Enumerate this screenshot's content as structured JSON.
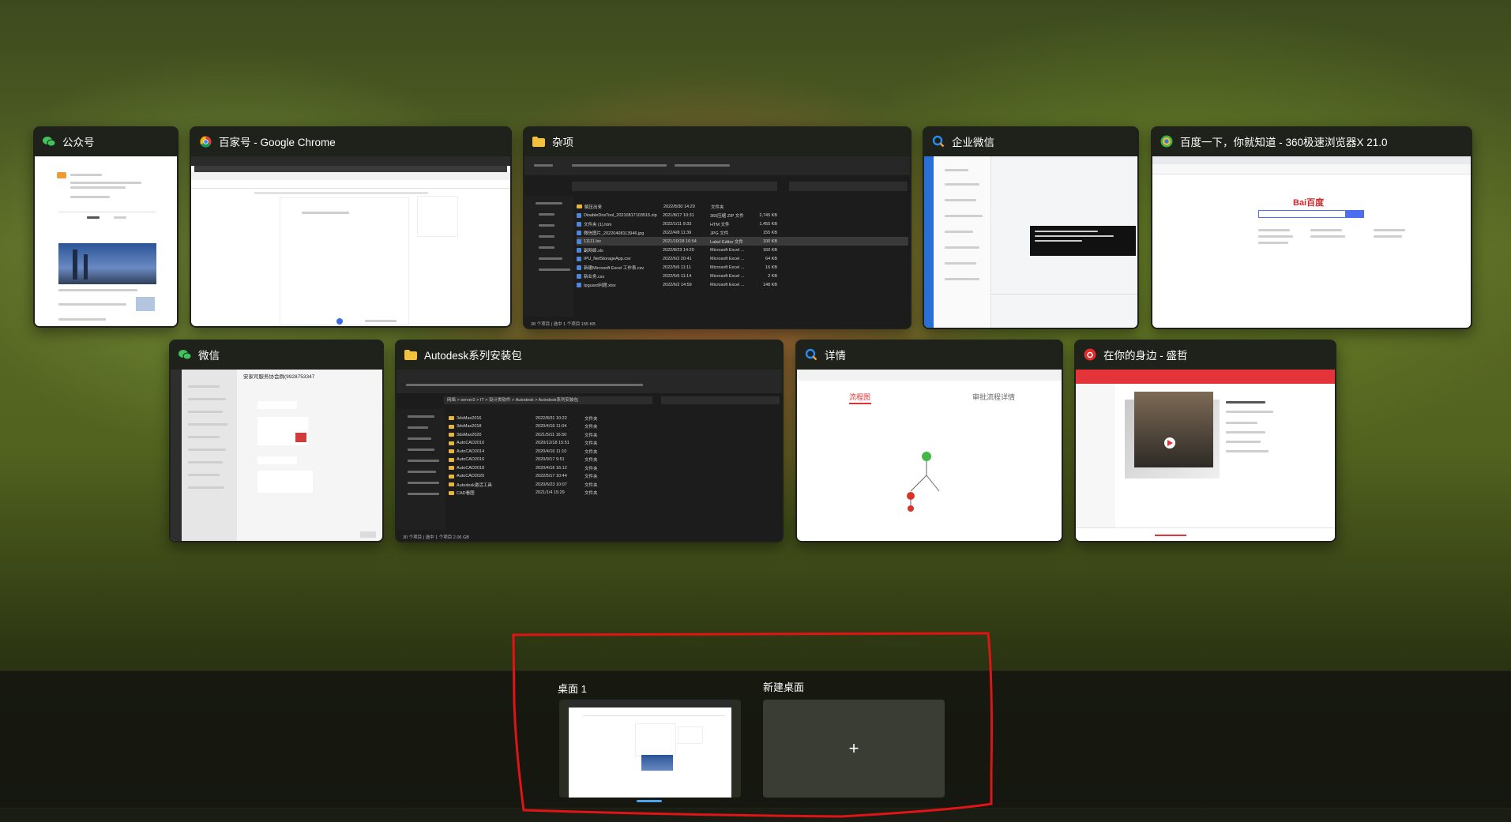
{
  "windows": {
    "gzh": {
      "title": "公众号",
      "icon": "wechat-icon"
    },
    "baijiahao": {
      "title": "百家号 - Google Chrome",
      "icon": "chrome-icon"
    },
    "zaxiang": {
      "title": "杂项",
      "icon": "folder-icon",
      "rows": [
        {
          "name": "解压出来",
          "date": "2022/8/30 14:29",
          "type": "文件夹",
          "size": ""
        },
        {
          "name": "DisableDnsTool_20210817103515.zip",
          "date": "2021/8/17 10:31",
          "type": "360压缩 ZIP 文件",
          "size": "2,745 KB"
        },
        {
          "name": "文件夹 (1).htm",
          "date": "2022/1/11 9:33",
          "type": "HTM 文件",
          "size": "1,455 KB"
        },
        {
          "name": "微信图片_20220408113946.jpg",
          "date": "2022/4/8 11:39",
          "type": "JPG 文件",
          "size": "155 KB"
        },
        {
          "name": "11111.lsx",
          "date": "2021/10/18 16:54",
          "type": "Label Editor 文件",
          "size": "100 KB"
        },
        {
          "name": "副网络.xls",
          "date": "2022/8/23 14:20",
          "type": "Microsoft Excel ...",
          "size": "160 KB"
        },
        {
          "name": "IPU_NetStorageApp.csv",
          "date": "2022/6/2 20:41",
          "type": "Microsoft Excel ...",
          "size": "64 KB"
        },
        {
          "name": "新建Microsoft Excel 工作表.csv",
          "date": "2022/5/6 11:11",
          "type": "Microsoft Excel ...",
          "size": "16 KB"
        },
        {
          "name": "新业务.csv",
          "date": "2022/5/6 11:14",
          "type": "Microsoft Excel ...",
          "size": "2 KB"
        },
        {
          "name": "Ipguard问题.xlsx",
          "date": "2022/6/2 14:59",
          "type": "Microsoft Excel ...",
          "size": "148 KB"
        }
      ],
      "status": "38 个项目 | 选中 1 个项目 155 KB"
    },
    "qywx": {
      "title": "企业微信",
      "icon": "wecom-icon"
    },
    "browser360": {
      "title": "百度一下，你就知道 - 360极速浏览器X 21.0",
      "icon": "360-browser-icon",
      "logo": "Bai百度"
    },
    "weixin": {
      "title": "微信",
      "icon": "wechat-icon",
      "contact": "安家司服务协会群(9928753347"
    },
    "autodesk": {
      "title": "Autodesk系列安装包",
      "icon": "folder-icon",
      "path": "网络 > server2 > IT > 设计类软件 > Autodesk > Autodesk系列安装包",
      "rows": [
        {
          "name": "3dsMax2016",
          "date": "2022/8/31 10:22",
          "type": "文件夹"
        },
        {
          "name": "3dsMax2018",
          "date": "2020/4/16 11:04",
          "type": "文件夹"
        },
        {
          "name": "3dsMax2020",
          "date": "2021/5/11 16:50",
          "type": "文件夹"
        },
        {
          "name": "AutoCAD2010",
          "date": "2020/12/18 15:51",
          "type": "文件夹"
        },
        {
          "name": "AutoCAD2014",
          "date": "2020/4/16 11:10",
          "type": "文件夹"
        },
        {
          "name": "AutoCAD2016",
          "date": "2020/9/17 9:51",
          "type": "文件夹"
        },
        {
          "name": "AutoCAD2018",
          "date": "2020/4/16 16:12",
          "type": "文件夹"
        },
        {
          "name": "AutoCAD2020",
          "date": "2022/5/17 10:44",
          "type": "文件夹"
        },
        {
          "name": "Autodesk激活工具",
          "date": "2020/6/23 10:07",
          "type": "文件夹"
        },
        {
          "name": "CAD看图",
          "date": "2021/1/4 15:29",
          "type": "文件夹"
        }
      ],
      "status": "30 个项目 | 选中 1 个项目 2.06 GB"
    },
    "xiangqing": {
      "title": "详情",
      "icon": "wecom-icon",
      "tab1": "流程图",
      "tab2": "审批流程详情"
    },
    "music": {
      "title": "在你的身边 - 盛哲",
      "icon": "netease-music-icon"
    }
  },
  "desktops": {
    "desk1_label": "桌面 1",
    "new_label": "新建桌面",
    "plus": "+"
  }
}
